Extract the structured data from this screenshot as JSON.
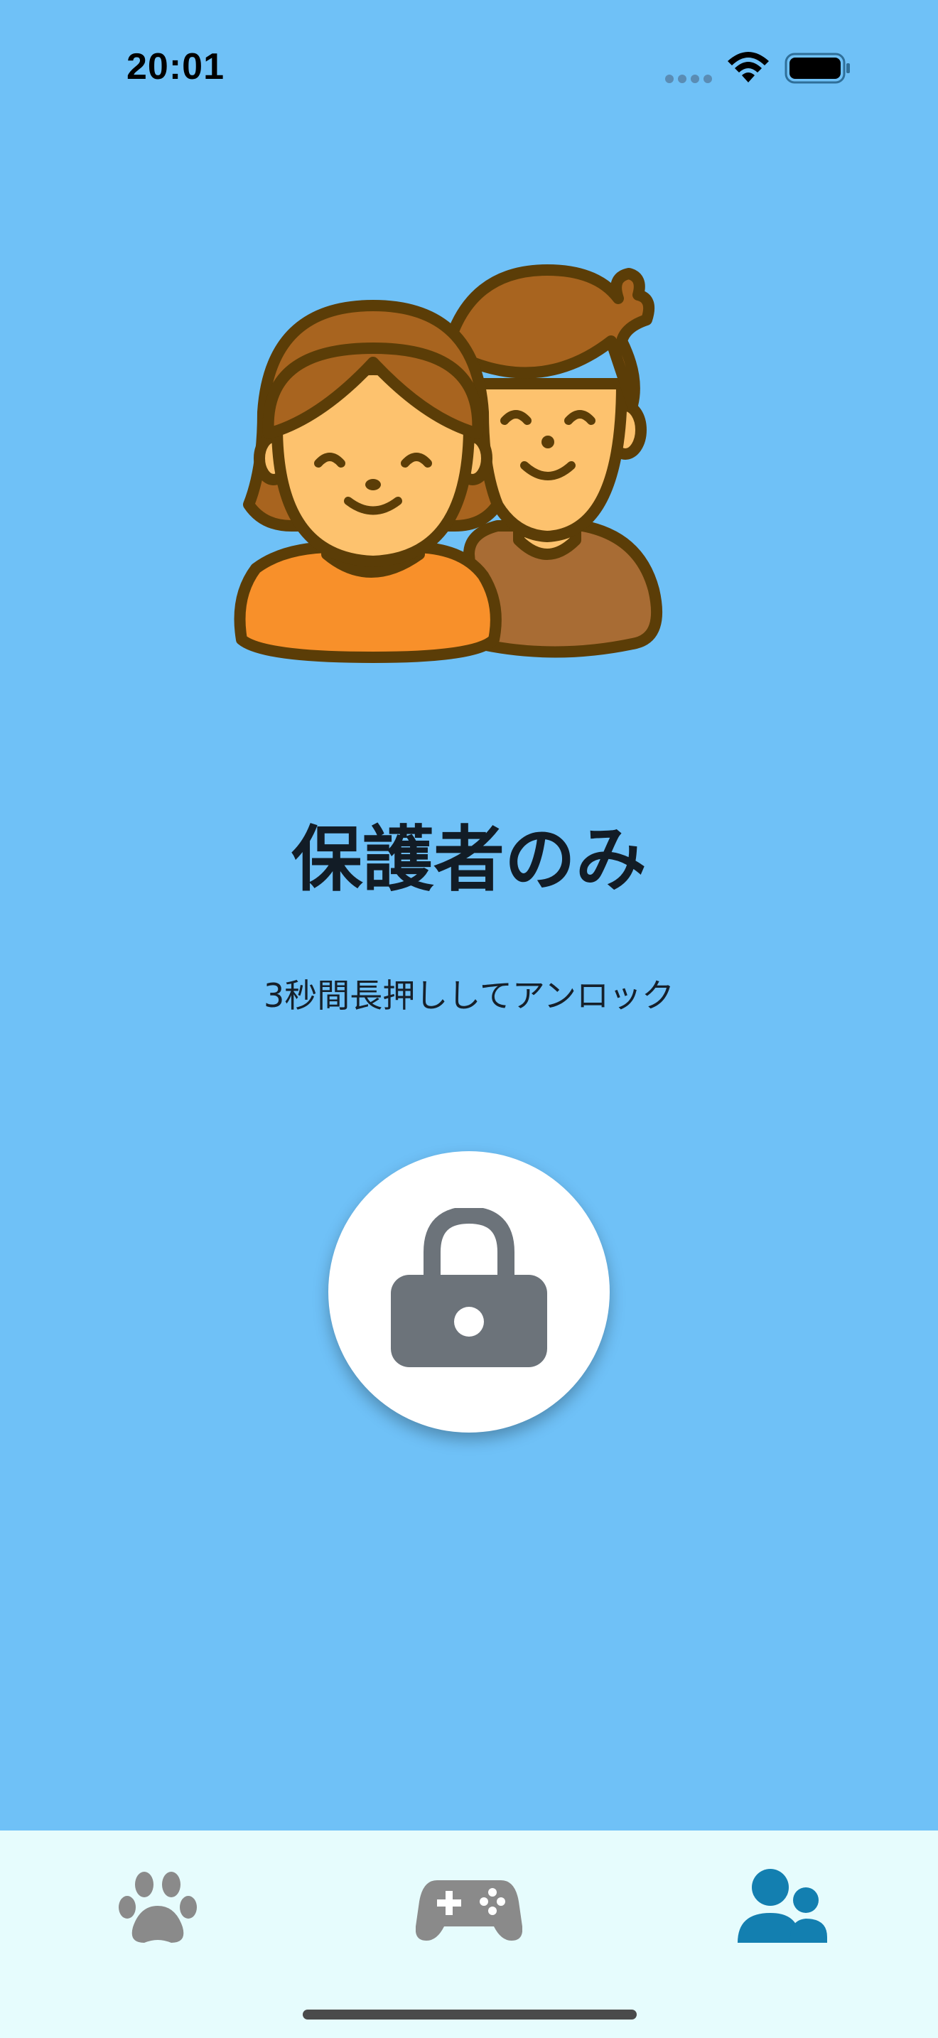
{
  "status_bar": {
    "time": "20:01"
  },
  "lock_screen": {
    "illustration": "family-parents-icon",
    "title": "保護者のみ",
    "subtitle": "3秒間長押ししてアンロック",
    "lock_icon": "lock-icon"
  },
  "tab_bar": {
    "items": [
      {
        "icon": "paw-icon",
        "active": false
      },
      {
        "icon": "gamepad-icon",
        "active": false
      },
      {
        "icon": "parents-icon",
        "active": true
      }
    ],
    "colors": {
      "inactive": "#8a8a8a",
      "active": "#137fb0"
    }
  },
  "colors": {
    "background": "#6fc1f7",
    "tab_bar_background": "#e6fcfd"
  }
}
